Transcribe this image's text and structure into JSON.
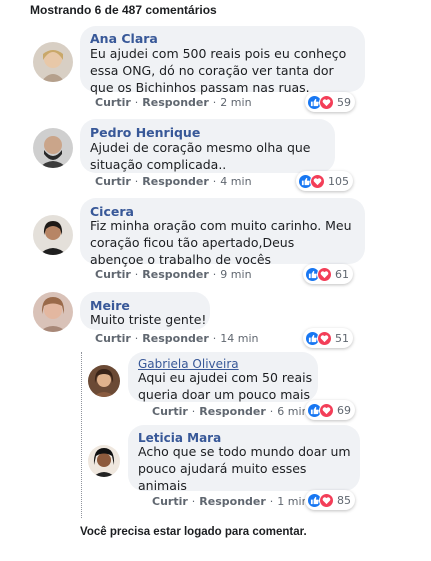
{
  "header": {
    "count_text": "Mostrando 6 de 487 comentários"
  },
  "actions": {
    "reply_like": "Curtir",
    "reply": "Responder",
    "separator": "·"
  },
  "comments": [
    {
      "author": "Ana Clara",
      "text": "Eu ajudei com 500 reais pois eu conheço\nessa ONG, dó no coração ver tanta dor\nque os Bichinhos passam nas ruas.",
      "time": "2 min",
      "reactions": "59"
    },
    {
      "author": "Pedro Henrique",
      "text": "Ajudei de coração mesmo olha que\nsituação complicada..",
      "time": "4 min",
      "reactions": "105"
    },
    {
      "author": "Cicera",
      "text": "Fiz minha oração com muito carinho. Meu\ncoração ficou tão apertado,Deus\nabençoe o trabalho de vocês",
      "time": "9 min",
      "reactions": "61"
    },
    {
      "author": "Meire",
      "text": "Muito triste gente!",
      "time": "14 min",
      "reactions": "51"
    }
  ],
  "replies": [
    {
      "author": "Gabriela Oliveira",
      "text": "Aqui eu ajudei com 50 reais\nqueria doar um pouco mais",
      "time": "6 min",
      "reactions": "69"
    },
    {
      "author": "Leticia Mara",
      "text": "Acho que se todo mundo doar um\npouco ajudará muito esses\nanimais",
      "time": "1 min",
      "reactions": "85"
    }
  ],
  "footer": {
    "login_notice": "Você precisa estar logado para comentar."
  },
  "colors": {
    "link": "#385898",
    "like": "#1877f2",
    "love": "#f33e58",
    "bubble": "#f0f2f5"
  },
  "icons": {
    "like": "thumbs-up-icon",
    "love": "heart-icon"
  }
}
